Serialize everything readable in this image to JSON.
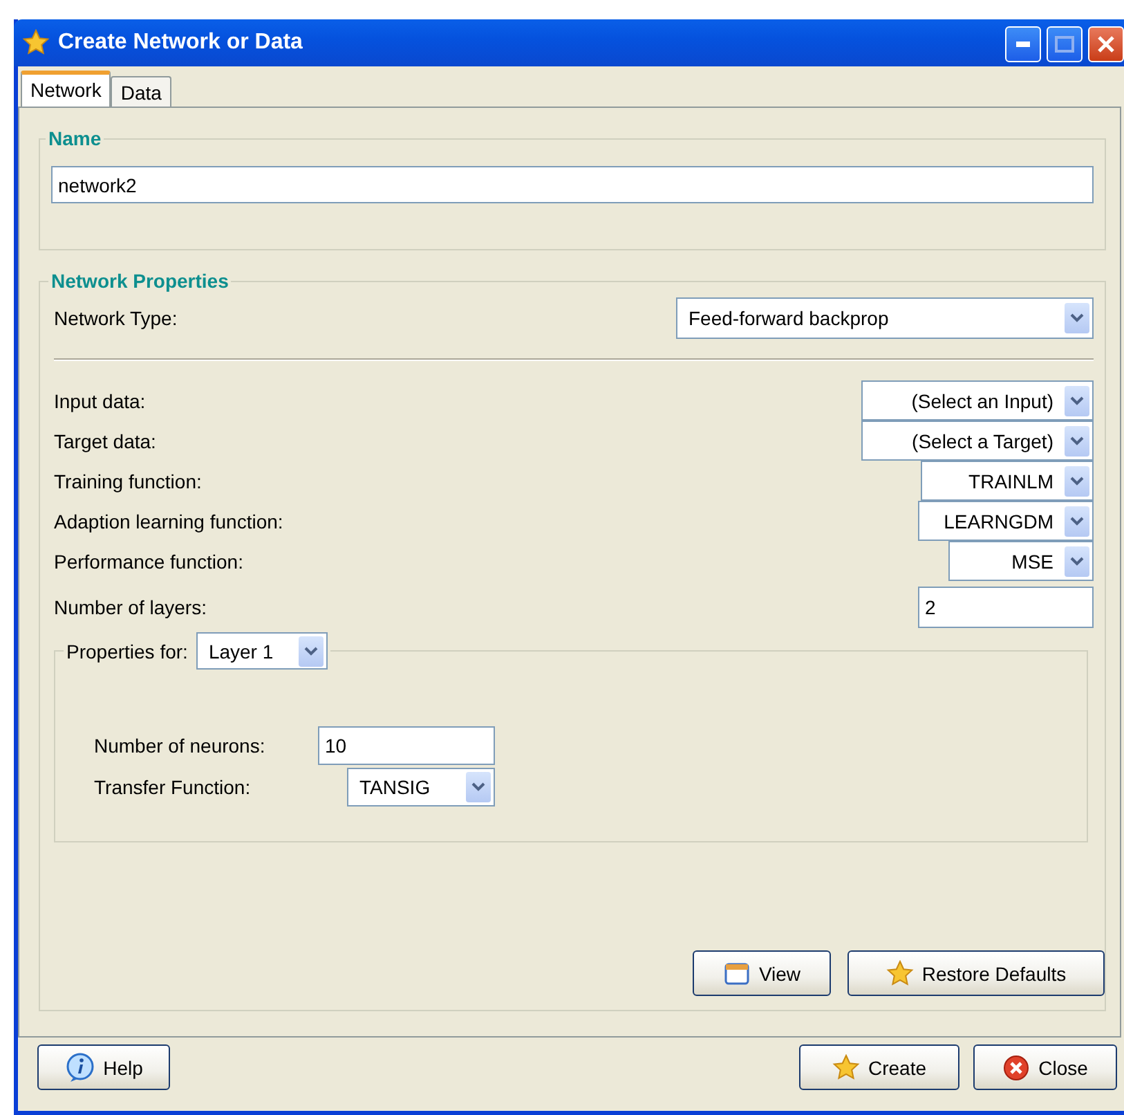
{
  "window": {
    "title": "Create Network or Data"
  },
  "tabs": [
    {
      "label": "Network",
      "selected": true
    },
    {
      "label": "Data",
      "selected": false
    }
  ],
  "name_group": {
    "title": "Name",
    "value": "network2"
  },
  "properties_group": {
    "title": "Network Properties",
    "network_type": {
      "label": "Network Type:",
      "value": "Feed-forward backprop"
    },
    "fields": [
      {
        "kind": "combo",
        "label": "Input data:",
        "value": "(Select an Input)"
      },
      {
        "kind": "combo",
        "label": "Target data:",
        "value": "(Select a Target)"
      },
      {
        "kind": "combo",
        "label": "Training function:",
        "value": "TRAINLM"
      },
      {
        "kind": "combo",
        "label": "Adaption learning function:",
        "value": "LEARNGDM"
      },
      {
        "kind": "combo",
        "label": "Performance function:",
        "value": "MSE"
      },
      {
        "kind": "text",
        "label": "Number of layers:",
        "value": "2"
      }
    ],
    "layer_group": {
      "label": "Properties for:",
      "value": "Layer 1",
      "fields": [
        {
          "kind": "text",
          "label": "Number of neurons:",
          "value": "10"
        },
        {
          "kind": "combo",
          "label": "Transfer Function:",
          "value": "TANSIG"
        }
      ]
    },
    "buttons": [
      {
        "label": "View"
      },
      {
        "label": "Restore Defaults"
      }
    ]
  },
  "footer_buttons": [
    {
      "label": "Help"
    },
    {
      "label": "Create"
    },
    {
      "label": "Close"
    }
  ]
}
